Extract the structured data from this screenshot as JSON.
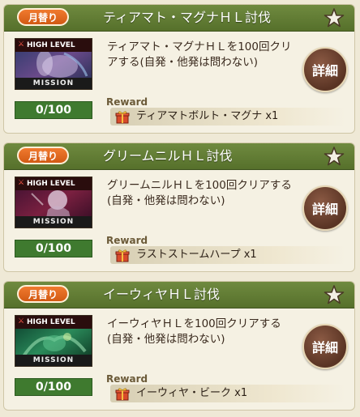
{
  "colors": {
    "header": "#56702b",
    "badge": "#d25a14",
    "card_bg": "#f5f1e3",
    "progress_bg": "#3f7a2f",
    "detail_button": "#5a3424"
  },
  "missions": [
    {
      "badge": "月替り",
      "title": "ティアマト・マグナＨＬ討伐",
      "favorite_icon": "star-icon",
      "thumb": {
        "top": "HIGH LEVEL",
        "bottom": "MISSION",
        "art": "tiamat-art"
      },
      "progress": "0/100",
      "progress_fraction": 0,
      "description": "ティアマト・マグナＨＬを100回クリアする(自発・他発は問わない)",
      "detail_label": "詳細",
      "reward_label": "Reward",
      "reward_icon": "gift-icon",
      "reward": "ティアマトボルト・マグナ x1"
    },
    {
      "badge": "月替り",
      "title": "グリームニルＨＬ討伐",
      "favorite_icon": "star-icon",
      "thumb": {
        "top": "HIGH LEVEL",
        "bottom": "MISSION",
        "art": "grimnir-art"
      },
      "progress": "0/100",
      "progress_fraction": 0,
      "description": "グリームニルＨＬを100回クリアする(自発・他発は問わない)",
      "detail_label": "詳細",
      "reward_label": "Reward",
      "reward_icon": "gift-icon",
      "reward": "ラストストームハープ x1"
    },
    {
      "badge": "月替り",
      "title": "イーウィヤＨＬ討伐",
      "favorite_icon": "star-icon",
      "thumb": {
        "top": "HIGH LEVEL",
        "bottom": "MISSION",
        "art": "yggdrasil-art"
      },
      "progress": "0/100",
      "progress_fraction": 0,
      "description": "イーウィヤＨＬを100回クリアする(自発・他発は問わない)",
      "detail_label": "詳細",
      "reward_label": "Reward",
      "reward_icon": "gift-icon",
      "reward": "イーウィヤ・ビーク x1"
    }
  ]
}
